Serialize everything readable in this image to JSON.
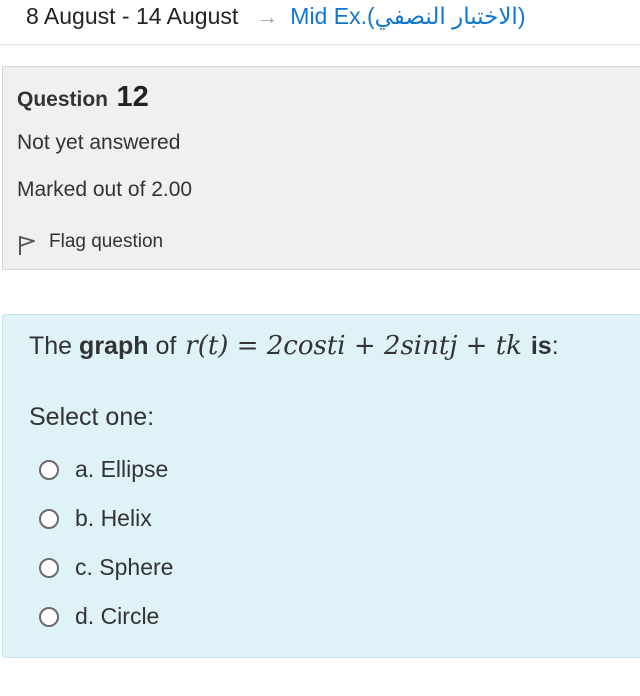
{
  "breadcrumb": {
    "current": "8 August - 14 August",
    "separator": "→",
    "link": "Mid Ex.(الاختبار النصفي)"
  },
  "question_info": {
    "label": "Question",
    "number": "12",
    "state": "Not yet answered",
    "grade": "Marked out of 2.00",
    "flag_label": "Flag question",
    "flag_icon": "flag-icon"
  },
  "question": {
    "text_prefix": "The",
    "text_bold": "graph",
    "text_mid": "of",
    "formula": "r(t) = 2costi + 2sintj + tk",
    "text_suffix_bold": "is",
    "text_end": ":",
    "prompt": "Select one:",
    "options": [
      {
        "label": "a. Ellipse"
      },
      {
        "label": "b. Helix"
      },
      {
        "label": "c. Sphere"
      },
      {
        "label": "d. Circle"
      }
    ]
  },
  "colors": {
    "link": "#1177d1",
    "info_bg": "#f0f0f0",
    "formulation_bg": "#def2f8"
  }
}
